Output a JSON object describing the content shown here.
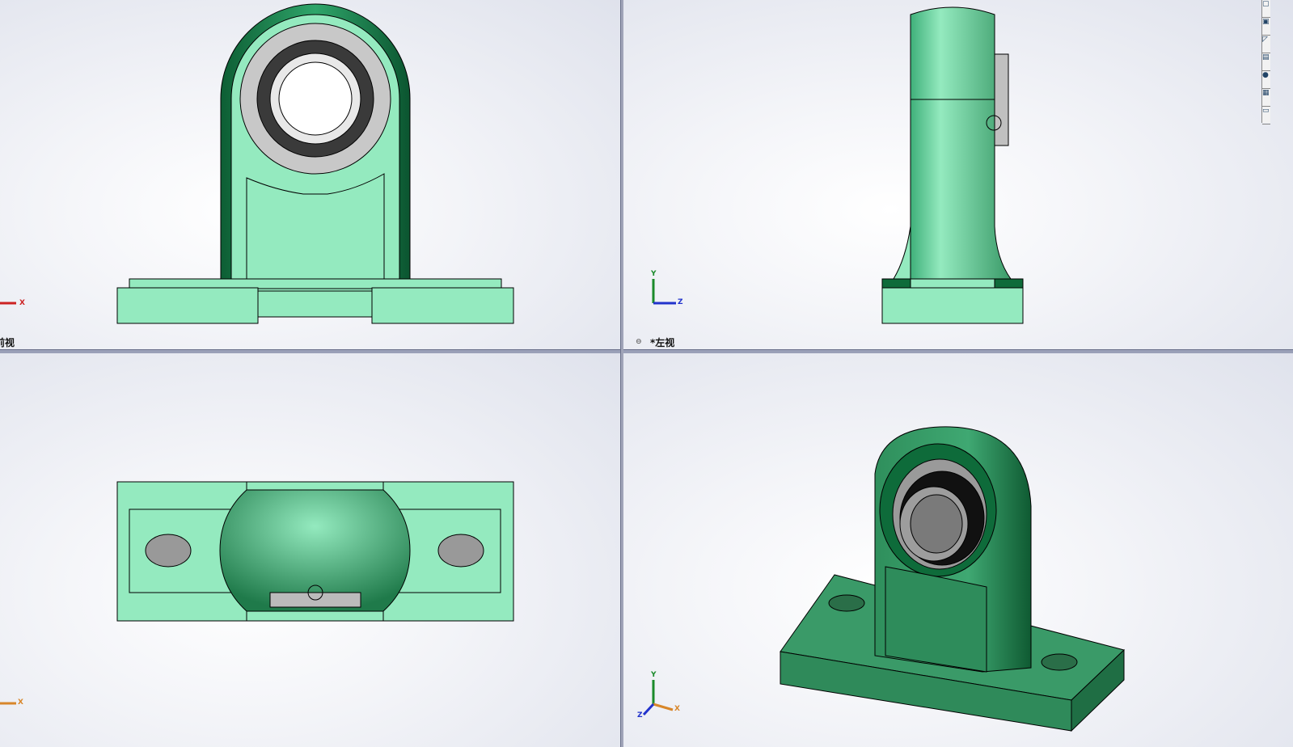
{
  "viewports": {
    "front": {
      "label": "前视",
      "axis": "X"
    },
    "left": {
      "label": "*左视",
      "axes": [
        "Y",
        "Z"
      ]
    },
    "top": {
      "axis": "X"
    },
    "iso": {
      "axes": [
        "Y",
        "X",
        "Z"
      ]
    }
  },
  "toolbar": {
    "icons": [
      "view-icon",
      "section-icon",
      "edit-icon",
      "display-icon",
      "appearance-icon",
      "scene-icon",
      "comment-icon"
    ]
  },
  "colors": {
    "part_light": "#94eabf",
    "part_dark": "#0e6b3a",
    "iso_green": "#3a9a68"
  }
}
